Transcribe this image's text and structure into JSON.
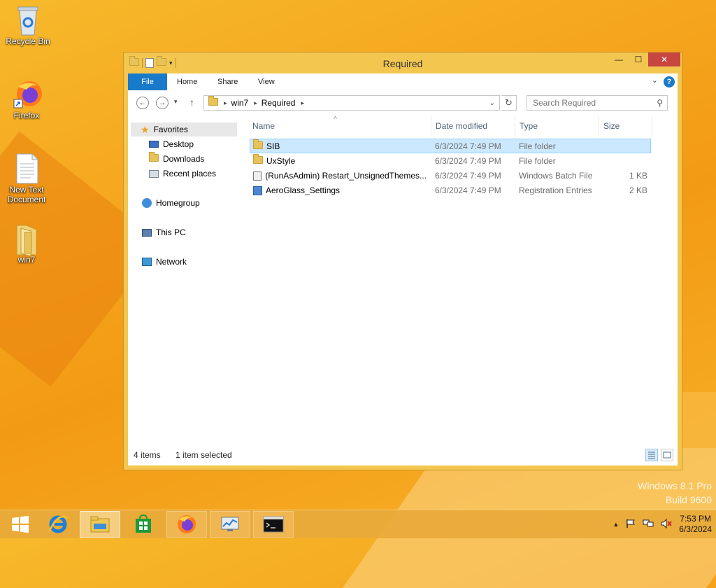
{
  "desktop": {
    "icons": [
      {
        "label": "Recycle Bin"
      },
      {
        "label": "Firefox"
      },
      {
        "label": "New Text Document"
      },
      {
        "label": "win7"
      }
    ],
    "watermark_line1": "Windows 8.1 Pro",
    "watermark_line2": "Build 9600"
  },
  "window": {
    "title": "Required",
    "controls": {
      "minimize": "—",
      "maximize": "☐",
      "close": "✕"
    },
    "ribbon": {
      "tabs": [
        "File",
        "Home",
        "Share",
        "View"
      ]
    },
    "address": {
      "segments": [
        "win7",
        "Required"
      ]
    },
    "search": {
      "placeholder": "Search Required"
    },
    "navpane": {
      "favorites": "Favorites",
      "fav_items": [
        "Desktop",
        "Downloads",
        "Recent places"
      ],
      "homegroup": "Homegroup",
      "thispc": "This PC",
      "network": "Network"
    },
    "columns": {
      "name": "Name",
      "date": "Date modified",
      "type": "Type",
      "size": "Size"
    },
    "files": [
      {
        "name": "SIB",
        "date": "6/3/2024 7:49 PM",
        "type": "File folder",
        "size": "",
        "icon": "folder-icon"
      },
      {
        "name": "UxStyle",
        "date": "6/3/2024 7:49 PM",
        "type": "File folder",
        "size": "",
        "icon": "folder-icon"
      },
      {
        "name": "(RunAsAdmin) Restart_UnsignedThemes...",
        "date": "6/3/2024 7:49 PM",
        "type": "Windows Batch File",
        "size": "1 KB",
        "icon": "batch-file-icon"
      },
      {
        "name": "AeroGlass_Settings",
        "date": "6/3/2024 7:49 PM",
        "type": "Registration Entries",
        "size": "2 KB",
        "icon": "registry-file-icon"
      }
    ],
    "status": {
      "items": "4 items",
      "selected": "1 item selected"
    }
  },
  "taskbar": {
    "clock_time": "7:53 PM",
    "clock_date": "6/3/2024"
  },
  "colors": {
    "accent": "#1979ca",
    "selection": "#cce8ff",
    "window_frame": "#f3c650"
  }
}
